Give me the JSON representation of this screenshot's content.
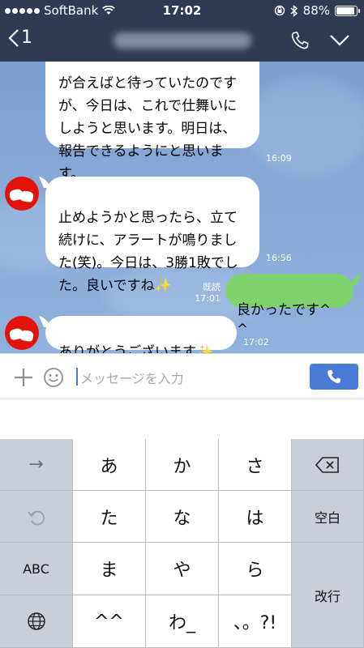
{
  "status_bar": {
    "carrier": "SoftBank",
    "time": "17:02",
    "battery": "88%"
  },
  "header": {
    "back_count": "1"
  },
  "messages": [
    {
      "from": "other",
      "text": "が合えばと待っていたのですが、今日は、これで仕舞いにしようと思います。明日は、報告できるようにと思います。",
      "time": "16:09"
    },
    {
      "from": "other",
      "text": "止めようかと思ったら、立て続けに、アラートが鳴りました(笑)。今日は、3勝1敗でした。良いですね✨",
      "time": "16:56"
    },
    {
      "from": "me",
      "text": "良かったです^ ^",
      "read": "既読",
      "time": "17:01"
    },
    {
      "from": "other",
      "text": "ありがとうございます✨",
      "time": "17:02"
    }
  ],
  "input": {
    "placeholder": "メッセージを入力"
  },
  "keyboard": {
    "row1": [
      "→",
      "あ",
      "か",
      "さ",
      "⌫"
    ],
    "row2": [
      "↺",
      "た",
      "な",
      "は",
      "空白"
    ],
    "row3": [
      "ABC",
      "ま",
      "や",
      "ら",
      "改行"
    ],
    "row4": [
      "globe",
      "^^",
      "わ_",
      "、。?!"
    ]
  }
}
